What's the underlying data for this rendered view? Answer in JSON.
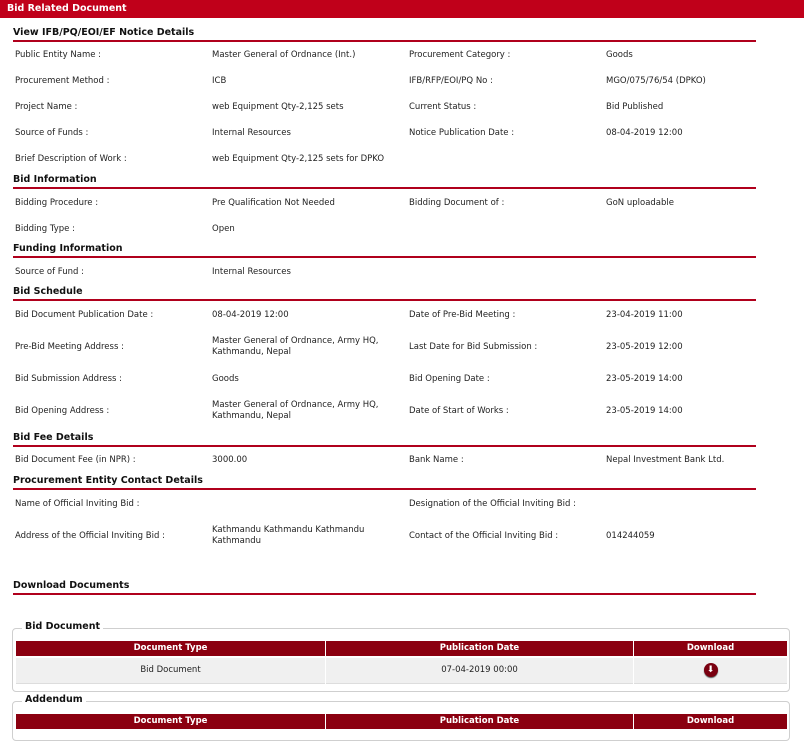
{
  "header": {
    "title": "Bid Related Document"
  },
  "sections": {
    "notice": "View IFB/PQ/EOI/EF Notice Details",
    "bid_info": "Bid Information",
    "funding": "Funding Information",
    "schedule": "Bid Schedule",
    "fee": "Bid Fee Details",
    "contact": "Procurement Entity Contact Details",
    "download": "Download Documents"
  },
  "notice": {
    "public_entity_label": "Public Entity Name :",
    "public_entity_value": "Master General of Ordnance (Int.)",
    "procurement_category_label": "Procurement Category :",
    "procurement_category_value": "Goods",
    "procurement_method_label": "Procurement Method :",
    "procurement_method_value": "ICB",
    "ifb_no_label": "IFB/RFP/EOI/PQ No :",
    "ifb_no_value": "MGO/075/76/54 (DPKO)",
    "project_name_label": "Project Name :",
    "project_name_value": "web Equipment Qty-2,125 sets",
    "current_status_label": "Current Status :",
    "current_status_value": "Bid Published",
    "source_of_funds_label": "Source of Funds :",
    "source_of_funds_value": "Internal Resources",
    "notice_pub_date_label": "Notice Publication Date :",
    "notice_pub_date_value": "08-04-2019 12:00",
    "brief_desc_label": "Brief Description of Work :",
    "brief_desc_value": "web Equipment Qty-2,125 sets for DPKO"
  },
  "bid_info": {
    "bidding_procedure_label": "Bidding Procedure :",
    "bidding_procedure_value": "Pre Qualification Not Needed",
    "bidding_document_label": "Bidding Document of :",
    "bidding_document_value": "GoN uploadable",
    "bidding_type_label": "Bidding Type :",
    "bidding_type_value": "Open"
  },
  "funding": {
    "source_of_fund_label": "Source of Fund :",
    "source_of_fund_value": "Internal Resources"
  },
  "schedule": {
    "doc_pub_date_label": "Bid Document Publication Date :",
    "doc_pub_date_value": "08-04-2019 12:00",
    "prebid_meeting_date_label": "Date of Pre-Bid Meeting :",
    "prebid_meeting_date_value": "23-04-2019 11:00",
    "prebid_address_label": "Pre-Bid Meeting Address :",
    "prebid_address_value": "Master General of Ordnance, Army HQ, Kathmandu, Nepal",
    "last_date_label": "Last Date for Bid Submission :",
    "last_date_value": "23-05-2019 12:00",
    "submission_address_label": "Bid Submission Address :",
    "submission_address_value": "Goods",
    "opening_date_label": "Bid Opening Date :",
    "opening_date_value": "23-05-2019 14:00",
    "opening_address_label": "Bid Opening Address :",
    "opening_address_value": "Master General of Ordnance, Army HQ, Kathmandu, Nepal",
    "start_works_label": "Date of Start of Works :",
    "start_works_value": "23-05-2019 14:00"
  },
  "fee": {
    "doc_fee_label": "Bid Document Fee (in NPR) :",
    "doc_fee_value": "3000.00",
    "bank_name_label": "Bank Name :",
    "bank_name_value": "Nepal Investment Bank Ltd."
  },
  "contact": {
    "official_name_label": "Name of Official Inviting Bid :",
    "official_name_value": "",
    "designation_label": "Designation of the Official Inviting Bid :",
    "designation_value": "",
    "address_label": "Address of the Official Inviting Bid :",
    "address_value": "Kathmandu Kathmandu Kathmandu Kathmandu",
    "contact_label": "Contact of the Official Inviting Bid :",
    "contact_value": "014244059"
  },
  "bid_document": {
    "legend": "Bid Document",
    "headers": [
      "Document Type",
      "Publication Date",
      "Download"
    ],
    "row": {
      "type": "Bid Document",
      "date": "07-04-2019 00:00"
    },
    "download_icon": "download-icon"
  },
  "addendum": {
    "legend": "Addendum",
    "headers": [
      "Document Type",
      "Publication Date",
      "Download"
    ]
  },
  "colors": {
    "accent": "#c0001a",
    "table_header": "#8b0010"
  }
}
